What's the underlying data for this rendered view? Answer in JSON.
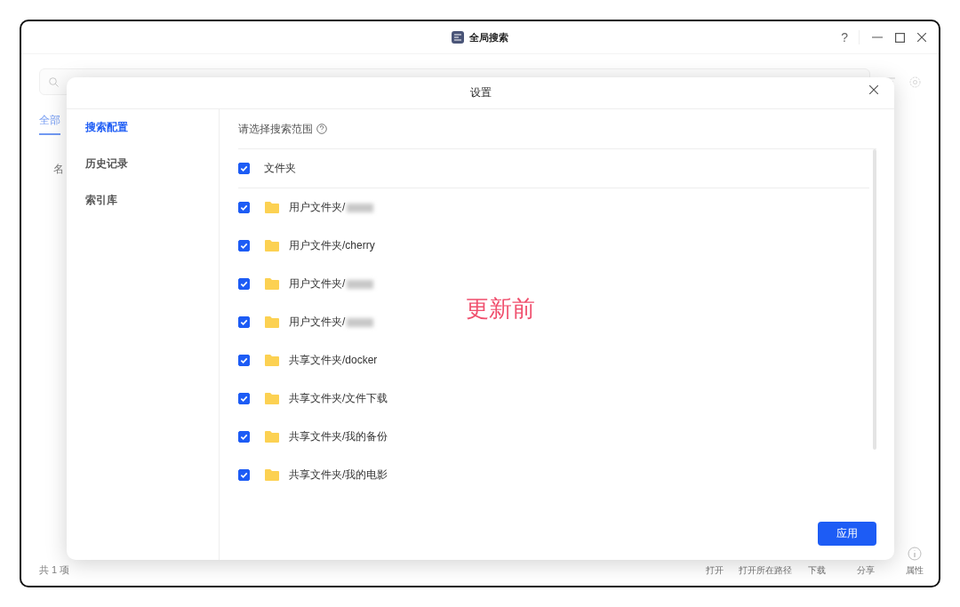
{
  "window": {
    "title": "全局搜索",
    "help": "?"
  },
  "background": {
    "tabs": [
      {
        "label": "全部",
        "selected": true
      }
    ],
    "column_1": "名",
    "footer": "共 1 项",
    "actions": [
      {
        "label": "打开",
        "kind": "text"
      },
      {
        "label": "打开所在路径",
        "kind": "text"
      },
      {
        "label": "下载",
        "kind": "text"
      },
      {
        "label": "分享",
        "kind": "text"
      },
      {
        "label": "属性",
        "kind": "icon"
      }
    ]
  },
  "dialog": {
    "title": "设置",
    "nav": [
      {
        "label": "搜索配置",
        "selected": true
      },
      {
        "label": "历史记录",
        "selected": false
      },
      {
        "label": "索引库",
        "selected": false
      }
    ],
    "scope_label": "请选择搜索范围",
    "folders_header": {
      "label": "文件夹",
      "checked": true
    },
    "folders": [
      {
        "label": "用户文件夹/",
        "checked": true,
        "redacted": true
      },
      {
        "label": "用户文件夹/cherry",
        "checked": true,
        "redacted": false
      },
      {
        "label": "用户文件夹/",
        "checked": true,
        "redacted": true
      },
      {
        "label": "用户文件夹/",
        "checked": true,
        "redacted": true
      },
      {
        "label": "共享文件夹/docker",
        "checked": true,
        "redacted": false
      },
      {
        "label": "共享文件夹/文件下载",
        "checked": true,
        "redacted": false
      },
      {
        "label": "共享文件夹/我的备份",
        "checked": true,
        "redacted": false
      },
      {
        "label": "共享文件夹/我的电影",
        "checked": true,
        "redacted": false
      }
    ],
    "apply": "应用"
  },
  "annotation": {
    "text": "更新前"
  }
}
